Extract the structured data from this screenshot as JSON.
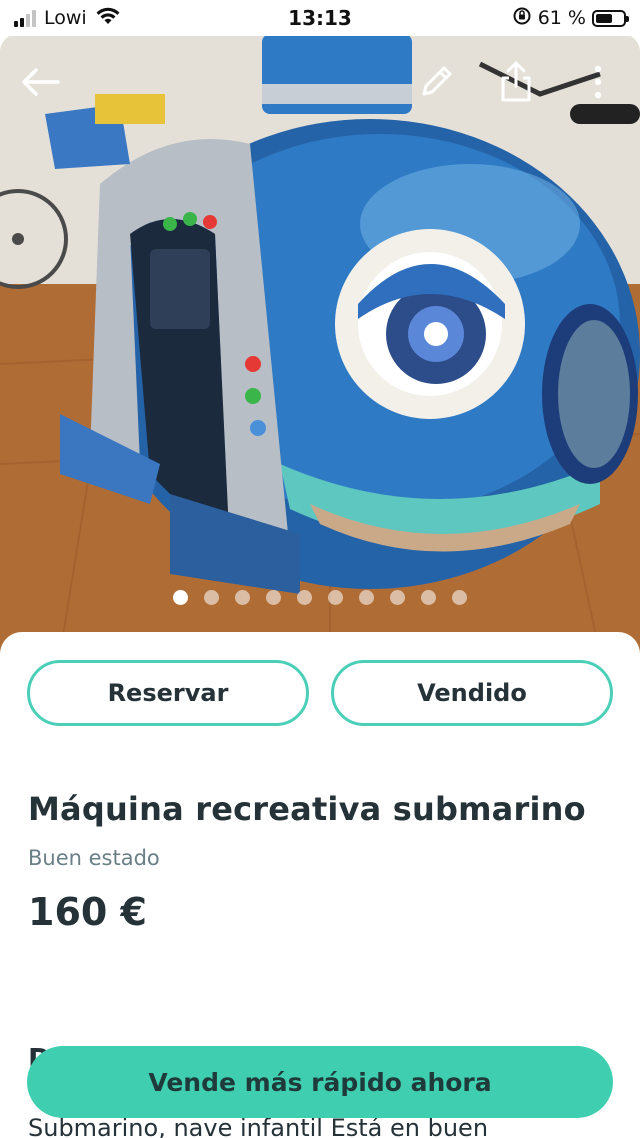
{
  "status_bar": {
    "carrier": "Lowi",
    "time": "13:13",
    "battery_percent": "61 %",
    "battery_level": 0.61,
    "icons": [
      "signal-icon",
      "wifi-icon",
      "orientation-lock-icon",
      "battery-icon"
    ]
  },
  "hero": {
    "icons": [
      "back-arrow-icon",
      "edit-pencil-icon",
      "share-icon",
      "more-vertical-icon"
    ],
    "image_count": 10,
    "active_image": 1
  },
  "actions": {
    "reserve_label": "Reservar",
    "sold_label": "Vendido"
  },
  "listing": {
    "title": "Máquina recreativa submarino",
    "condition": "Buen estado",
    "price": "160 €",
    "description_heading_partial": "D",
    "description_partial": "Submarino, nave infantil Está en buen"
  },
  "cta": {
    "label": "Vende más rápido ahora"
  },
  "colors": {
    "accent": "#3fcfb0",
    "outline": "#4ccfb8",
    "text": "#253238",
    "muted": "#6b7f86"
  }
}
